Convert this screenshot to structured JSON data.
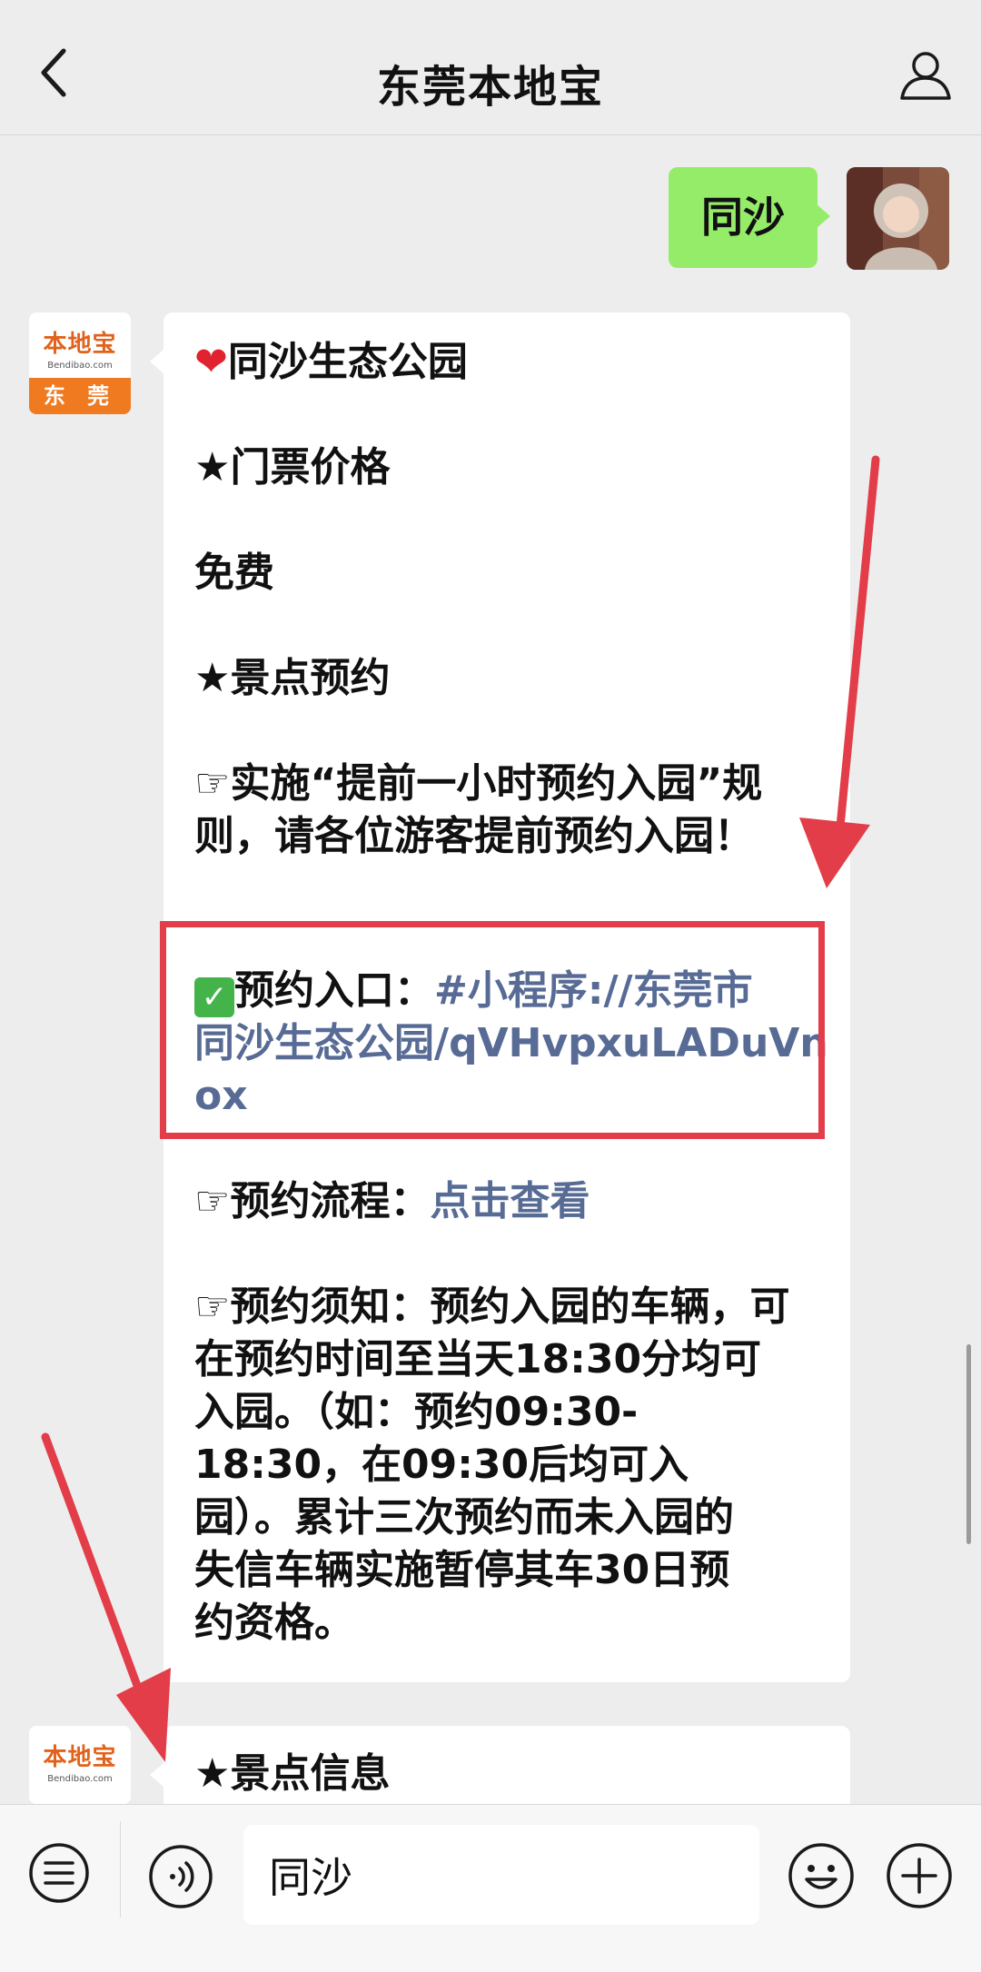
{
  "header": {
    "title": "东莞本地宝"
  },
  "sent_message": {
    "text": "同沙"
  },
  "bot": {
    "avatar_brand": "本地宝",
    "avatar_url": "Bendibao.com",
    "avatar_city": "东 莞"
  },
  "message1": {
    "park_name": "同沙生态公园",
    "ticket_heading": "★门票价格",
    "ticket_value": "免费",
    "booking_heading": "★景点预约",
    "rule_line1": "☞实施“提前一小时预约入园”规",
    "rule_line2": "则，请各位游客提前预约入园！",
    "entry_label": "预约入口：",
    "entry_link_line1": "#小程序://东莞市",
    "entry_link_line2": "同沙生态公园/qVHvpxuLADuVn",
    "entry_link_line3": "ox",
    "process_label": "☞预约流程：",
    "process_link": "点击查看",
    "notice_line1": "☞预约须知：预约入园的车辆，可",
    "notice_line2": "在预约时间至当天18:30分均可",
    "notice_line3": "入园。（如：预约09:30-",
    "notice_line4": "18:30，在09:30后均可入",
    "notice_line5": "园）。累计三次预约而未入园的",
    "notice_line6": "失信车辆实施暂停其车30日预",
    "notice_line7": "约资格。"
  },
  "message2": {
    "heading": "★景点信息"
  },
  "input_bar": {
    "input_value": "同沙"
  },
  "colors": {
    "background": "#ededed",
    "sent_bubble": "#95ec69",
    "link": "#576b95",
    "annotation_red": "#e23d49",
    "brand_orange": "#f07a20"
  },
  "icons": [
    "back-arrow-icon",
    "person-icon",
    "heart-icon",
    "check-mark-icon",
    "menu-icon",
    "voice-icon",
    "emoji-icon",
    "plus-icon",
    "red-arrow-annotation"
  ]
}
